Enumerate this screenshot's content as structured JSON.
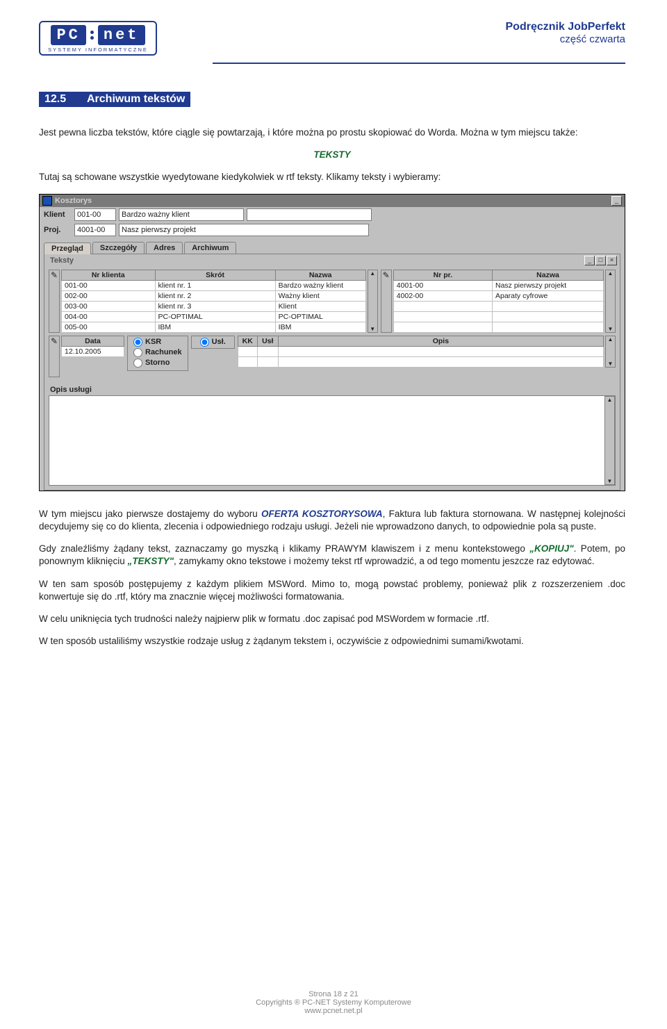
{
  "header": {
    "logo_l": "PC",
    "logo_r": "net",
    "logo_sub": "SYSTEMY INFORMATYCZNE",
    "title": "Podręcznik JobPerfekt",
    "subtitle": "część czwarta"
  },
  "section": {
    "num": "12.5",
    "title": "Archiwum tekstów"
  },
  "para1": "Jest pewna liczba tekstów, które ciągle się powtarzają, i które można po prostu skopiować do Worda. Można w tym miejscu także:",
  "kw_teksty": "TEKSTY",
  "para2": "Tutaj są schowane wszystkie wyedytowane kiedykolwiek w rtf teksty. Klikamy teksty i  wybieramy:",
  "para3a": "W tym miejscu jako pierwsze dostajemy do wyboru ",
  "kw_oferta": "OFERTA KOSZTORYSOWA",
  "para3b": ", Faktura lub faktura stornowana. W następnej kolejności decydujemy się co do klienta, zlecenia i odpowiedniego rodzaju usługi. Jeżeli nie wprowadzono danych, to odpowiednie pola są puste.",
  "para4a": "Gdy znaleźliśmy żądany tekst, zaznaczamy go myszką i klikamy PRAWYM klawiszem i z menu kontekstowego ",
  "kw_kopiuj": "„KOPIUJ\"",
  "para4b": ". Potem, po ponownym kliknięciu ",
  "kw_teksty2": "„TEKSTY\"",
  "para4c": ", zamykamy okno tekstowe i możemy tekst rtf wprowadzić, a od tego momentu jeszcze raz edytować.",
  "para5": "W ten sam sposób postępujemy z każdym plikiem MSWord. Mimo to, mogą powstać problemy, ponieważ plik z rozszerzeniem .doc konwertuje się do .rtf, który ma znacznie więcej możliwości formatowania.",
  "para6": "W celu uniknięcia tych trudności należy najpierw plik w formatu .doc zapisać pod MSWordem  w formacie .rtf.",
  "para7": "W ten sposób ustaliliśmy wszystkie rodzaje usług z żądanym tekstem i, oczywiście z odpowiednimi sumami/kwotami.",
  "app": {
    "title": "Kosztorys",
    "klient_lbl": "Klient",
    "klient_code": "001-00",
    "klient_name": "Bardzo ważny klient",
    "proj_lbl": "Proj.",
    "proj_code": "4001-00",
    "proj_name": "Nasz pierwszy projekt",
    "tabs": [
      "Przegląd",
      "Szczegóły",
      "Adres",
      "Archiwum"
    ],
    "inner_title": "Teksty",
    "left_headers": [
      "Nr klienta",
      "Skrót",
      "Nazwa"
    ],
    "left_rows": [
      [
        "001-00",
        "klient nr. 1",
        "Bardzo ważny klient"
      ],
      [
        "002-00",
        "klient nr. 2",
        "Ważny klient"
      ],
      [
        "003-00",
        "klient nr. 3",
        "Klient"
      ],
      [
        "004-00",
        "PC-OPTIMAL",
        "PC-OPTIMAL"
      ],
      [
        "005-00",
        "IBM",
        "IBM"
      ]
    ],
    "right_headers": [
      "Nr pr.",
      "Nazwa"
    ],
    "right_rows": [
      [
        "4001-00",
        "Nasz pierwszy projekt"
      ],
      [
        "4002-00",
        "Aparaty cyfrowe"
      ]
    ],
    "data_hdr": "Data",
    "data_val": "12.10.2005",
    "radio1": "KSR",
    "radio2": "Rachunek",
    "radio3": "Storno",
    "usl_lbl": "Usł.",
    "kk_hdr": "KK",
    "usl_hdr": "Usł",
    "opis_hdr": "Opis",
    "opis_lbl": "Opis usługi"
  },
  "footer": {
    "l1": "Strona 18 z 21",
    "l2": "Copyrights ® PC-NET Systemy Komputerowe",
    "l3": "www.pcnet.net.pl"
  }
}
